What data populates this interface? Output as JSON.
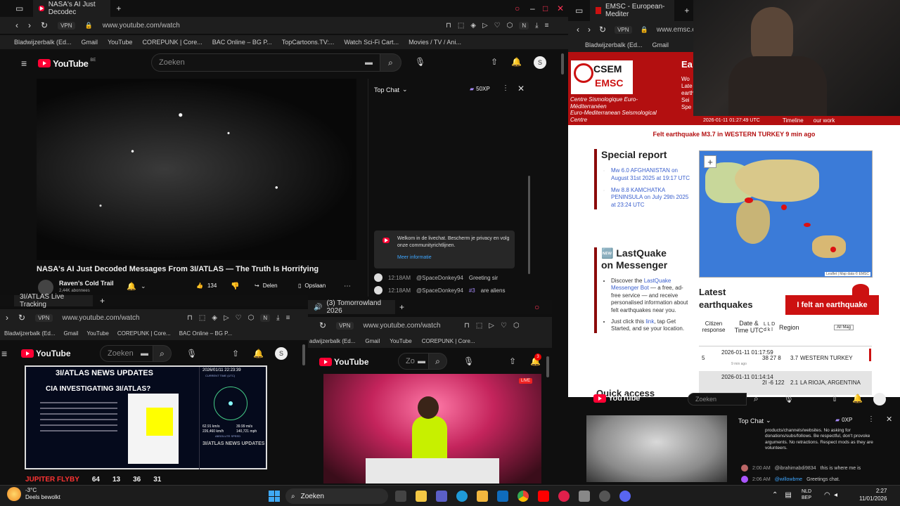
{
  "win1": {
    "tab_title": "NASA's AI Just Decodec",
    "url": "www.youtube.com/watch",
    "vpn": "VPN",
    "bookmarks": [
      "Bladwijzerbalk (Ed...",
      "Gmail",
      "YouTube",
      "COREPUNK | Core...",
      "BAC Online – BG P...",
      "TopCartoons.TV:...",
      "Watch Sci-Fi Cart...",
      "Movies / TV / Ani..."
    ],
    "yt_logo": "YouTube",
    "yt_region": "BE",
    "search_placeholder": "Zoeken",
    "avatar_letter": "S",
    "video_title": "NASA's AI Just Decoded Messages From 3I/ATLAS — The Truth Is Horrifying",
    "channel": "Raven's Cold Trail",
    "subs": "2,44K abonnees",
    "likes": "134",
    "share": "Delen",
    "save": "Opslaan",
    "chat_title": "Top Chat",
    "chat_xp": "50XP",
    "chat_notice": "Welkom in de livechat. Bescherm je privacy en volg onze communityrichtlijnen.",
    "chat_more": "Meer informatie",
    "chat_msgs": [
      {
        "time": "12:18AM",
        "user": "@SpaceDonkey94",
        "text": "Greeting sir"
      },
      {
        "time": "12:18AM",
        "user": "@SpaceDonkey94",
        "badge": "#3",
        "text": "are aliens"
      }
    ]
  },
  "win2": {
    "tab_title": "3I/ATLAS Live Tracking",
    "url": "www.youtube.com/watch",
    "bookmarks": [
      "Bladwijzerbalk (Ed...",
      "Gmail",
      "YouTube",
      "COREPUNK | Core...",
      "BAC Online – BG P..."
    ],
    "search_placeholder": "Zoeken",
    "avatar_letter": "S",
    "thumb_header": "3I/ATLAS NEWS UPDATES",
    "thumb_q": "CIA INVESTIGATING 3I/ATLAS?",
    "thumb_time": "2026/01/11 22:23:39",
    "thumb_time_label": "CURRENT TIME (UTC)",
    "thumb_speed1": "62.91 km/s",
    "thumb_speed2": "39.99 mi/s",
    "thumb_speed3": "226,460 km/h",
    "thumb_speed4": "140,721 mph",
    "thumb_speed_label": "ABSOLUTE SPEED",
    "thumb_sub": "3I/ATLAS NEWS UPDATES",
    "ticker": [
      "JUPITER FLYBY",
      "64",
      "13",
      "36",
      "31"
    ]
  },
  "win3": {
    "tab_title": "(3) Tomorrowland 2026",
    "url": "www.youtube.com/watch",
    "bookmarks": [
      "adwijzerbalk (Ed...",
      "Gmail",
      "YouTube",
      "COREPUNK | Core..."
    ],
    "search_placeholder": "Zo",
    "notif_count": "3",
    "live": "LIVE"
  },
  "emsc": {
    "tab_title": "EMSC - European-Mediter",
    "url": "www.emsc.eu",
    "vpn": "VPN",
    "bookmarks": [
      "Bladwijzerbalk (Ed...",
      "Gmail"
    ],
    "logo_top": "CSEM",
    "logo_bottom": "EMSC",
    "org_line1": "Centre Sismologique Euro-",
    "org_line2": "Méditerranéen",
    "org_line3": "Euro-Mediterranean Seismological",
    "org_line4": "Centre",
    "header_ea": "Ea",
    "header_lines": [
      "Wo",
      "Late",
      "earth",
      "Sei",
      "Spe"
    ],
    "timestamp": "2026-01-11 01:27:49 UTC",
    "nav_timeline": "Timeline",
    "nav_work": "our work",
    "felt_banner": "Felt earthquake M3.7 in WESTERN TURKEY 9 min ago",
    "special_title": "Special report",
    "special_links": [
      "Mw 6.0 AFGHANISTAN on August 31st 2025 at 19:17 UTC",
      "Mw 8.8 KAMCHATKA PENINSULA on July 29th 2025 at 23:24 UTC"
    ],
    "lastquake_title1": "🆕 LastQuake",
    "lastquake_title2": "on Messenger",
    "lastquake_item1_a": "Discover the ",
    "lastquake_item1_link": "LastQuake Messenger Bot",
    "lastquake_item1_b": " — a free, ad-free service — and receive personalised information about felt earthquakes near you.",
    "lastquake_item2_a": "Just click this ",
    "lastquake_item2_link": "link",
    "lastquake_item2_b": ", tap Get Started, and se your location.",
    "map_attrib": "Leaflet | Map data © EMSC",
    "map_zoom": "+",
    "latest_title1": "Latest",
    "latest_title2": "earthquakes",
    "felt_button": "I felt an earthquake",
    "cols": {
      "citizen": "Citizen response",
      "date": "Date & Time UTC",
      "lld": "L L D d k l",
      "region": "Region",
      "filter": "All Mag"
    },
    "quakes": [
      {
        "resp": "5",
        "date": "2026-01-11 01:17:59",
        "ago": "9 min ago",
        "mag": "38 27 8",
        "m": "3.7",
        "region": "WESTERN TURKEY"
      },
      {
        "resp": "",
        "date": "2026-01-11 01:14:14",
        "ago": "",
        "mag": "2I -6 122",
        "m": "2.1",
        "region": "LA RIOJA, ARGENTINA"
      }
    ],
    "quick_access": "Quick access"
  },
  "win4": {
    "yt_logo": "YouTube",
    "search_placeholder": "Zoeken",
    "chat_title": "Top Chat",
    "chat_xp": "0XP",
    "rules": "products/channels/websites. No asking for donations/subs/follows. Be respectful, don't provoke arguments. No retractions. Respect mods as they are volunteers.",
    "msgs": [
      {
        "time": "2:00 AM",
        "user": "@ibrahimabdi9834",
        "text": "this is where me is"
      },
      {
        "time": "2:06 AM",
        "user": "@willowbme",
        "text": "Greetings chat."
      }
    ]
  },
  "taskbar": {
    "weather_temp": "-3°C",
    "weather_text": "Deels bewolkt",
    "search": "Zoeken",
    "lang1": "NLD",
    "lang2": "BEP",
    "time": "2:27",
    "date": "11/01/2026"
  }
}
